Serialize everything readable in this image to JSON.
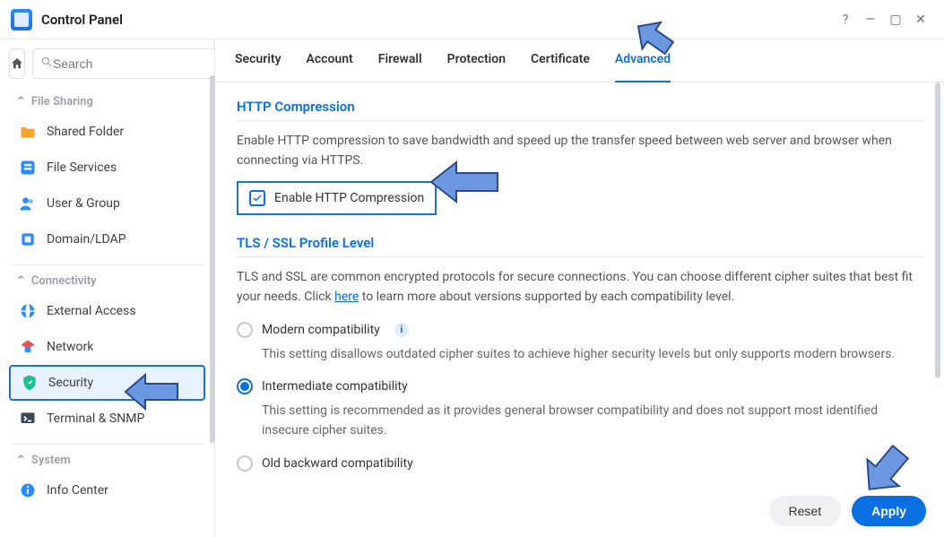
{
  "window": {
    "title": "Control Panel"
  },
  "search": {
    "placeholder": "Search"
  },
  "sidebar": {
    "groups": [
      {
        "label": "File Sharing",
        "items": [
          {
            "label": "Shared Folder"
          },
          {
            "label": "File Services"
          },
          {
            "label": "User & Group"
          },
          {
            "label": "Domain/LDAP"
          }
        ]
      },
      {
        "label": "Connectivity",
        "items": [
          {
            "label": "External Access"
          },
          {
            "label": "Network"
          },
          {
            "label": "Security"
          },
          {
            "label": "Terminal & SNMP"
          }
        ]
      },
      {
        "label": "System",
        "items": [
          {
            "label": "Info Center"
          }
        ]
      }
    ]
  },
  "tabs": [
    "Security",
    "Account",
    "Firewall",
    "Protection",
    "Certificate",
    "Advanced"
  ],
  "active_tab": 5,
  "sections": {
    "http": {
      "title": "HTTP Compression",
      "desc": "Enable HTTP compression to save bandwidth and speed up the transfer speed between web server and browser when connecting via HTTPS.",
      "checkbox_label": "Enable HTTP Compression",
      "checkbox_checked": true
    },
    "tls": {
      "title": "TLS / SSL Profile Level",
      "desc_pre": "TLS and SSL are common encrypted protocols for secure connections. You can choose different cipher suites that best fit your needs. Click ",
      "desc_link": "here",
      "desc_post": " to learn more about versions supported by each compatibility level.",
      "options": [
        {
          "label": "Modern compatibility",
          "info": true,
          "desc": "This setting disallows outdated cipher suites to achieve higher security levels but only supports modern browsers."
        },
        {
          "label": "Intermediate compatibility",
          "info": false,
          "desc": "This setting is recommended as it provides general browser compatibility and does not support most identified insecure cipher suites."
        },
        {
          "label": "Old backward compatibility",
          "info": false,
          "desc": ""
        }
      ],
      "selected": 1
    }
  },
  "buttons": {
    "reset": "Reset",
    "apply": "Apply"
  },
  "info_char": "i",
  "icons": {
    "help": "?",
    "minimize": "—",
    "maximize": "▢",
    "close": "✕",
    "chevron_up": "⌃",
    "search": "🔍",
    "home": "⌂",
    "check": "✓"
  }
}
